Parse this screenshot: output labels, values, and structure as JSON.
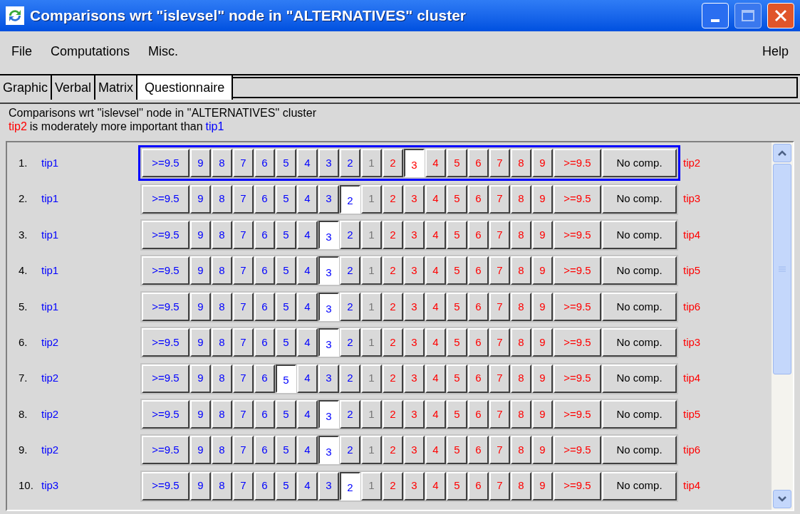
{
  "window": {
    "title": "Comparisons wrt \"islevsel\" node in \"ALTERNATIVES\" cluster"
  },
  "menu": [
    {
      "label": "File"
    },
    {
      "label": "Computations"
    },
    {
      "label": "Misc."
    },
    {
      "label": "Help"
    }
  ],
  "tabs": [
    {
      "label": "Graphic",
      "selected": false
    },
    {
      "label": "Verbal",
      "selected": false
    },
    {
      "label": "Matrix",
      "selected": false
    },
    {
      "label": "Questionnaire",
      "selected": true
    }
  ],
  "info": {
    "line_1": "Comparisons wrt ''islevsel'' node in ''ALTERNATIVES'' cluster",
    "verdict_left": "tip2",
    "verdict_middle": "is moderately more important than",
    "verdict_right": "tip1"
  },
  "rows": [
    {
      "number": "1.",
      "left": "tip1",
      "right": "tip2",
      "focused": true,
      "cells": [
        {
          "label": ">=9.5",
          "kind": "left",
          "selected": false
        },
        {
          "label": "9",
          "kind": "left",
          "selected": false
        },
        {
          "label": "8",
          "kind": "left",
          "selected": false
        },
        {
          "label": "7",
          "kind": "left",
          "selected": false
        },
        {
          "label": "6",
          "kind": "left",
          "selected": false
        },
        {
          "label": "5",
          "kind": "left",
          "selected": false
        },
        {
          "label": "4",
          "kind": "left",
          "selected": false
        },
        {
          "label": "3",
          "kind": "left",
          "selected": false
        },
        {
          "label": "2",
          "kind": "left",
          "selected": false
        },
        {
          "label": "1",
          "kind": "neutral",
          "selected": false
        },
        {
          "label": "2",
          "kind": "right",
          "selected": false
        },
        {
          "label": "3",
          "kind": "right",
          "selected": true
        },
        {
          "label": "4",
          "kind": "right",
          "selected": false
        },
        {
          "label": "5",
          "kind": "right",
          "selected": false
        },
        {
          "label": "6",
          "kind": "right",
          "selected": false
        },
        {
          "label": "7",
          "kind": "right",
          "selected": false
        },
        {
          "label": "8",
          "kind": "right",
          "selected": false
        },
        {
          "label": "9",
          "kind": "right",
          "selected": false
        },
        {
          "label": ">=9.5",
          "kind": "right",
          "selected": false
        },
        {
          "label": "No comp.",
          "kind": "none",
          "selected": false
        }
      ]
    },
    {
      "number": "2.",
      "left": "tip1",
      "right": "tip3",
      "focused": false,
      "cells": [
        {
          "label": ">=9.5",
          "kind": "left",
          "selected": false
        },
        {
          "label": "9",
          "kind": "left",
          "selected": false
        },
        {
          "label": "8",
          "kind": "left",
          "selected": false
        },
        {
          "label": "7",
          "kind": "left",
          "selected": false
        },
        {
          "label": "6",
          "kind": "left",
          "selected": false
        },
        {
          "label": "5",
          "kind": "left",
          "selected": false
        },
        {
          "label": "4",
          "kind": "left",
          "selected": false
        },
        {
          "label": "3",
          "kind": "left",
          "selected": false
        },
        {
          "label": "2",
          "kind": "left",
          "selected": true
        },
        {
          "label": "1",
          "kind": "neutral",
          "selected": false
        },
        {
          "label": "2",
          "kind": "right",
          "selected": false
        },
        {
          "label": "3",
          "kind": "right",
          "selected": false
        },
        {
          "label": "4",
          "kind": "right",
          "selected": false
        },
        {
          "label": "5",
          "kind": "right",
          "selected": false
        },
        {
          "label": "6",
          "kind": "right",
          "selected": false
        },
        {
          "label": "7",
          "kind": "right",
          "selected": false
        },
        {
          "label": "8",
          "kind": "right",
          "selected": false
        },
        {
          "label": "9",
          "kind": "right",
          "selected": false
        },
        {
          "label": ">=9.5",
          "kind": "right",
          "selected": false
        },
        {
          "label": "No comp.",
          "kind": "none",
          "selected": false
        }
      ]
    },
    {
      "number": "3.",
      "left": "tip1",
      "right": "tip4",
      "focused": false,
      "cells": [
        {
          "label": ">=9.5",
          "kind": "left",
          "selected": false
        },
        {
          "label": "9",
          "kind": "left",
          "selected": false
        },
        {
          "label": "8",
          "kind": "left",
          "selected": false
        },
        {
          "label": "7",
          "kind": "left",
          "selected": false
        },
        {
          "label": "6",
          "kind": "left",
          "selected": false
        },
        {
          "label": "5",
          "kind": "left",
          "selected": false
        },
        {
          "label": "4",
          "kind": "left",
          "selected": false
        },
        {
          "label": "3",
          "kind": "left",
          "selected": true
        },
        {
          "label": "2",
          "kind": "left",
          "selected": false
        },
        {
          "label": "1",
          "kind": "neutral",
          "selected": false
        },
        {
          "label": "2",
          "kind": "right",
          "selected": false
        },
        {
          "label": "3",
          "kind": "right",
          "selected": false
        },
        {
          "label": "4",
          "kind": "right",
          "selected": false
        },
        {
          "label": "5",
          "kind": "right",
          "selected": false
        },
        {
          "label": "6",
          "kind": "right",
          "selected": false
        },
        {
          "label": "7",
          "kind": "right",
          "selected": false
        },
        {
          "label": "8",
          "kind": "right",
          "selected": false
        },
        {
          "label": "9",
          "kind": "right",
          "selected": false
        },
        {
          "label": ">=9.5",
          "kind": "right",
          "selected": false
        },
        {
          "label": "No comp.",
          "kind": "none",
          "selected": false
        }
      ]
    },
    {
      "number": "4.",
      "left": "tip1",
      "right": "tip5",
      "focused": false,
      "cells": [
        {
          "label": ">=9.5",
          "kind": "left",
          "selected": false
        },
        {
          "label": "9",
          "kind": "left",
          "selected": false
        },
        {
          "label": "8",
          "kind": "left",
          "selected": false
        },
        {
          "label": "7",
          "kind": "left",
          "selected": false
        },
        {
          "label": "6",
          "kind": "left",
          "selected": false
        },
        {
          "label": "5",
          "kind": "left",
          "selected": false
        },
        {
          "label": "4",
          "kind": "left",
          "selected": false
        },
        {
          "label": "3",
          "kind": "left",
          "selected": true
        },
        {
          "label": "2",
          "kind": "left",
          "selected": false
        },
        {
          "label": "1",
          "kind": "neutral",
          "selected": false
        },
        {
          "label": "2",
          "kind": "right",
          "selected": false
        },
        {
          "label": "3",
          "kind": "right",
          "selected": false
        },
        {
          "label": "4",
          "kind": "right",
          "selected": false
        },
        {
          "label": "5",
          "kind": "right",
          "selected": false
        },
        {
          "label": "6",
          "kind": "right",
          "selected": false
        },
        {
          "label": "7",
          "kind": "right",
          "selected": false
        },
        {
          "label": "8",
          "kind": "right",
          "selected": false
        },
        {
          "label": "9",
          "kind": "right",
          "selected": false
        },
        {
          "label": ">=9.5",
          "kind": "right",
          "selected": false
        },
        {
          "label": "No comp.",
          "kind": "none",
          "selected": false
        }
      ]
    },
    {
      "number": "5.",
      "left": "tip1",
      "right": "tip6",
      "focused": false,
      "cells": [
        {
          "label": ">=9.5",
          "kind": "left",
          "selected": false
        },
        {
          "label": "9",
          "kind": "left",
          "selected": false
        },
        {
          "label": "8",
          "kind": "left",
          "selected": false
        },
        {
          "label": "7",
          "kind": "left",
          "selected": false
        },
        {
          "label": "6",
          "kind": "left",
          "selected": false
        },
        {
          "label": "5",
          "kind": "left",
          "selected": false
        },
        {
          "label": "4",
          "kind": "left",
          "selected": false
        },
        {
          "label": "3",
          "kind": "left",
          "selected": true
        },
        {
          "label": "2",
          "kind": "left",
          "selected": false
        },
        {
          "label": "1",
          "kind": "neutral",
          "selected": false
        },
        {
          "label": "2",
          "kind": "right",
          "selected": false
        },
        {
          "label": "3",
          "kind": "right",
          "selected": false
        },
        {
          "label": "4",
          "kind": "right",
          "selected": false
        },
        {
          "label": "5",
          "kind": "right",
          "selected": false
        },
        {
          "label": "6",
          "kind": "right",
          "selected": false
        },
        {
          "label": "7",
          "kind": "right",
          "selected": false
        },
        {
          "label": "8",
          "kind": "right",
          "selected": false
        },
        {
          "label": "9",
          "kind": "right",
          "selected": false
        },
        {
          "label": ">=9.5",
          "kind": "right",
          "selected": false
        },
        {
          "label": "No comp.",
          "kind": "none",
          "selected": false
        }
      ]
    },
    {
      "number": "6.",
      "left": "tip2",
      "right": "tip3",
      "focused": false,
      "cells": [
        {
          "label": ">=9.5",
          "kind": "left",
          "selected": false
        },
        {
          "label": "9",
          "kind": "left",
          "selected": false
        },
        {
          "label": "8",
          "kind": "left",
          "selected": false
        },
        {
          "label": "7",
          "kind": "left",
          "selected": false
        },
        {
          "label": "6",
          "kind": "left",
          "selected": false
        },
        {
          "label": "5",
          "kind": "left",
          "selected": false
        },
        {
          "label": "4",
          "kind": "left",
          "selected": false
        },
        {
          "label": "3",
          "kind": "left",
          "selected": true
        },
        {
          "label": "2",
          "kind": "left",
          "selected": false
        },
        {
          "label": "1",
          "kind": "neutral",
          "selected": false
        },
        {
          "label": "2",
          "kind": "right",
          "selected": false
        },
        {
          "label": "3",
          "kind": "right",
          "selected": false
        },
        {
          "label": "4",
          "kind": "right",
          "selected": false
        },
        {
          "label": "5",
          "kind": "right",
          "selected": false
        },
        {
          "label": "6",
          "kind": "right",
          "selected": false
        },
        {
          "label": "7",
          "kind": "right",
          "selected": false
        },
        {
          "label": "8",
          "kind": "right",
          "selected": false
        },
        {
          "label": "9",
          "kind": "right",
          "selected": false
        },
        {
          "label": ">=9.5",
          "kind": "right",
          "selected": false
        },
        {
          "label": "No comp.",
          "kind": "none",
          "selected": false
        }
      ]
    },
    {
      "number": "7.",
      "left": "tip2",
      "right": "tip4",
      "focused": false,
      "cells": [
        {
          "label": ">=9.5",
          "kind": "left",
          "selected": false
        },
        {
          "label": "9",
          "kind": "left",
          "selected": false
        },
        {
          "label": "8",
          "kind": "left",
          "selected": false
        },
        {
          "label": "7",
          "kind": "left",
          "selected": false
        },
        {
          "label": "6",
          "kind": "left",
          "selected": false
        },
        {
          "label": "5",
          "kind": "left",
          "selected": true
        },
        {
          "label": "4",
          "kind": "left",
          "selected": false
        },
        {
          "label": "3",
          "kind": "left",
          "selected": false
        },
        {
          "label": "2",
          "kind": "left",
          "selected": false
        },
        {
          "label": "1",
          "kind": "neutral",
          "selected": false
        },
        {
          "label": "2",
          "kind": "right",
          "selected": false
        },
        {
          "label": "3",
          "kind": "right",
          "selected": false
        },
        {
          "label": "4",
          "kind": "right",
          "selected": false
        },
        {
          "label": "5",
          "kind": "right",
          "selected": false
        },
        {
          "label": "6",
          "kind": "right",
          "selected": false
        },
        {
          "label": "7",
          "kind": "right",
          "selected": false
        },
        {
          "label": "8",
          "kind": "right",
          "selected": false
        },
        {
          "label": "9",
          "kind": "right",
          "selected": false
        },
        {
          "label": ">=9.5",
          "kind": "right",
          "selected": false
        },
        {
          "label": "No comp.",
          "kind": "none",
          "selected": false
        }
      ]
    },
    {
      "number": "8.",
      "left": "tip2",
      "right": "tip5",
      "focused": false,
      "cells": [
        {
          "label": ">=9.5",
          "kind": "left",
          "selected": false
        },
        {
          "label": "9",
          "kind": "left",
          "selected": false
        },
        {
          "label": "8",
          "kind": "left",
          "selected": false
        },
        {
          "label": "7",
          "kind": "left",
          "selected": false
        },
        {
          "label": "6",
          "kind": "left",
          "selected": false
        },
        {
          "label": "5",
          "kind": "left",
          "selected": false
        },
        {
          "label": "4",
          "kind": "left",
          "selected": false
        },
        {
          "label": "3",
          "kind": "left",
          "selected": true
        },
        {
          "label": "2",
          "kind": "left",
          "selected": false
        },
        {
          "label": "1",
          "kind": "neutral",
          "selected": false
        },
        {
          "label": "2",
          "kind": "right",
          "selected": false
        },
        {
          "label": "3",
          "kind": "right",
          "selected": false
        },
        {
          "label": "4",
          "kind": "right",
          "selected": false
        },
        {
          "label": "5",
          "kind": "right",
          "selected": false
        },
        {
          "label": "6",
          "kind": "right",
          "selected": false
        },
        {
          "label": "7",
          "kind": "right",
          "selected": false
        },
        {
          "label": "8",
          "kind": "right",
          "selected": false
        },
        {
          "label": "9",
          "kind": "right",
          "selected": false
        },
        {
          "label": ">=9.5",
          "kind": "right",
          "selected": false
        },
        {
          "label": "No comp.",
          "kind": "none",
          "selected": false
        }
      ]
    },
    {
      "number": "9.",
      "left": "tip2",
      "right": "tip6",
      "focused": false,
      "cells": [
        {
          "label": ">=9.5",
          "kind": "left",
          "selected": false
        },
        {
          "label": "9",
          "kind": "left",
          "selected": false
        },
        {
          "label": "8",
          "kind": "left",
          "selected": false
        },
        {
          "label": "7",
          "kind": "left",
          "selected": false
        },
        {
          "label": "6",
          "kind": "left",
          "selected": false
        },
        {
          "label": "5",
          "kind": "left",
          "selected": false
        },
        {
          "label": "4",
          "kind": "left",
          "selected": false
        },
        {
          "label": "3",
          "kind": "left",
          "selected": true
        },
        {
          "label": "2",
          "kind": "left",
          "selected": false
        },
        {
          "label": "1",
          "kind": "neutral",
          "selected": false
        },
        {
          "label": "2",
          "kind": "right",
          "selected": false
        },
        {
          "label": "3",
          "kind": "right",
          "selected": false
        },
        {
          "label": "4",
          "kind": "right",
          "selected": false
        },
        {
          "label": "5",
          "kind": "right",
          "selected": false
        },
        {
          "label": "6",
          "kind": "right",
          "selected": false
        },
        {
          "label": "7",
          "kind": "right",
          "selected": false
        },
        {
          "label": "8",
          "kind": "right",
          "selected": false
        },
        {
          "label": "9",
          "kind": "right",
          "selected": false
        },
        {
          "label": ">=9.5",
          "kind": "right",
          "selected": false
        },
        {
          "label": "No comp.",
          "kind": "none",
          "selected": false
        }
      ]
    },
    {
      "number": "10.",
      "left": "tip3",
      "right": "tip4",
      "focused": false,
      "cells": [
        {
          "label": ">=9.5",
          "kind": "left",
          "selected": false
        },
        {
          "label": "9",
          "kind": "left",
          "selected": false
        },
        {
          "label": "8",
          "kind": "left",
          "selected": false
        },
        {
          "label": "7",
          "kind": "left",
          "selected": false
        },
        {
          "label": "6",
          "kind": "left",
          "selected": false
        },
        {
          "label": "5",
          "kind": "left",
          "selected": false
        },
        {
          "label": "4",
          "kind": "left",
          "selected": false
        },
        {
          "label": "3",
          "kind": "left",
          "selected": false
        },
        {
          "label": "2",
          "kind": "left",
          "selected": true
        },
        {
          "label": "1",
          "kind": "neutral",
          "selected": false
        },
        {
          "label": "2",
          "kind": "right",
          "selected": false
        },
        {
          "label": "3",
          "kind": "right",
          "selected": false
        },
        {
          "label": "4",
          "kind": "right",
          "selected": false
        },
        {
          "label": "5",
          "kind": "right",
          "selected": false
        },
        {
          "label": "6",
          "kind": "right",
          "selected": false
        },
        {
          "label": "7",
          "kind": "right",
          "selected": false
        },
        {
          "label": "8",
          "kind": "right",
          "selected": false
        },
        {
          "label": "9",
          "kind": "right",
          "selected": false
        },
        {
          "label": ">=9.5",
          "kind": "right",
          "selected": false
        },
        {
          "label": "No comp.",
          "kind": "none",
          "selected": false
        }
      ]
    }
  ]
}
